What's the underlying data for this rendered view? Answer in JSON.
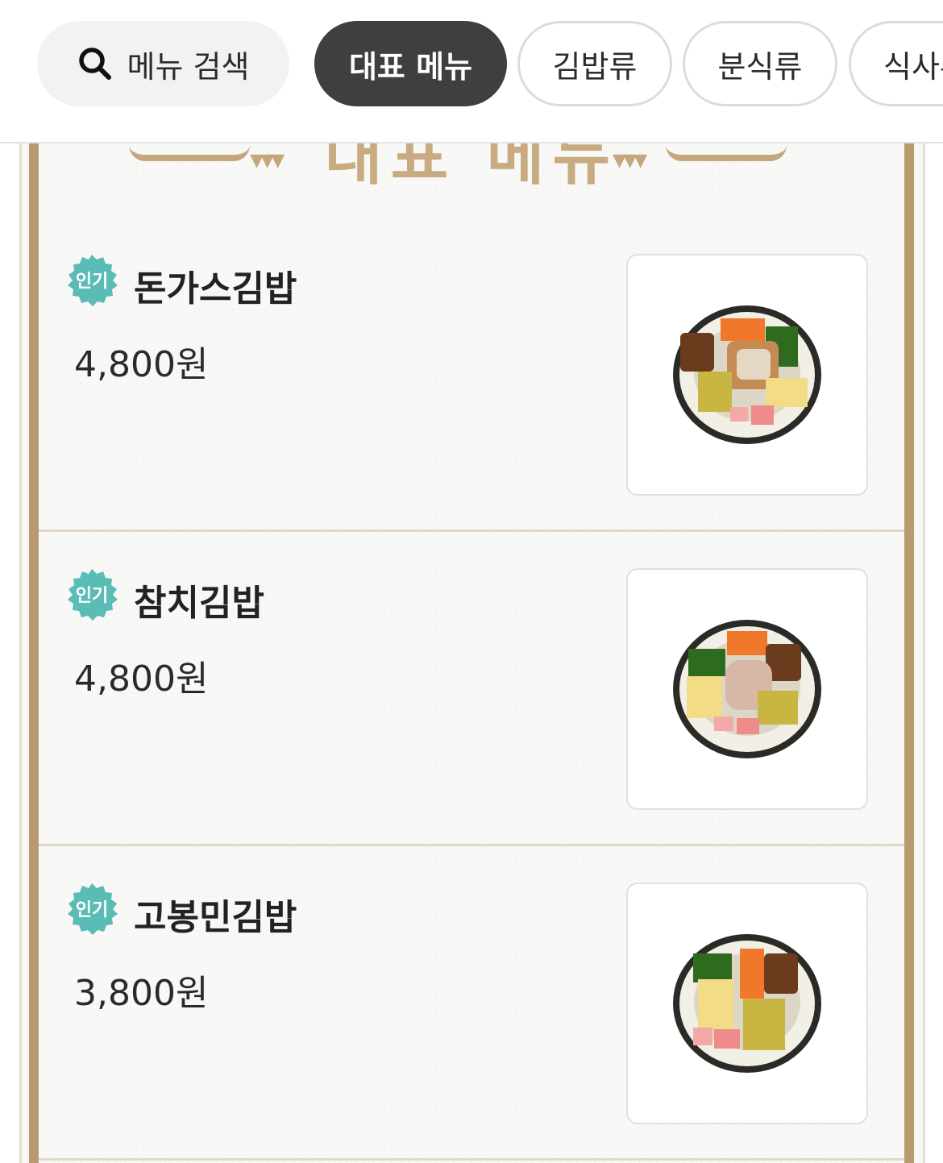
{
  "search": {
    "label": "메뉴 검색"
  },
  "categories": [
    {
      "label": "대표 메뉴",
      "active": true
    },
    {
      "label": "김밥류",
      "active": false
    },
    {
      "label": "분식류",
      "active": false
    },
    {
      "label": "식사류",
      "active": false
    }
  ],
  "section": {
    "title": "대표 메뉴"
  },
  "items": [
    {
      "badge": "인기",
      "name": "돈가스김밥",
      "price": "4,800원",
      "image": "donkatsu-kimbap-photo"
    },
    {
      "badge": "인기",
      "name": "참치김밥",
      "price": "4,800원",
      "image": "tuna-kimbap-photo"
    },
    {
      "badge": "인기",
      "name": "고봉민김밥",
      "price": "3,800원",
      "image": "gobongmin-kimbap-photo"
    }
  ],
  "colors": {
    "active_chip": "#3f3f3f",
    "badge": "#5bbcb6",
    "frame_gold": "#b99a6e",
    "header_gold": "#c8ab80"
  }
}
